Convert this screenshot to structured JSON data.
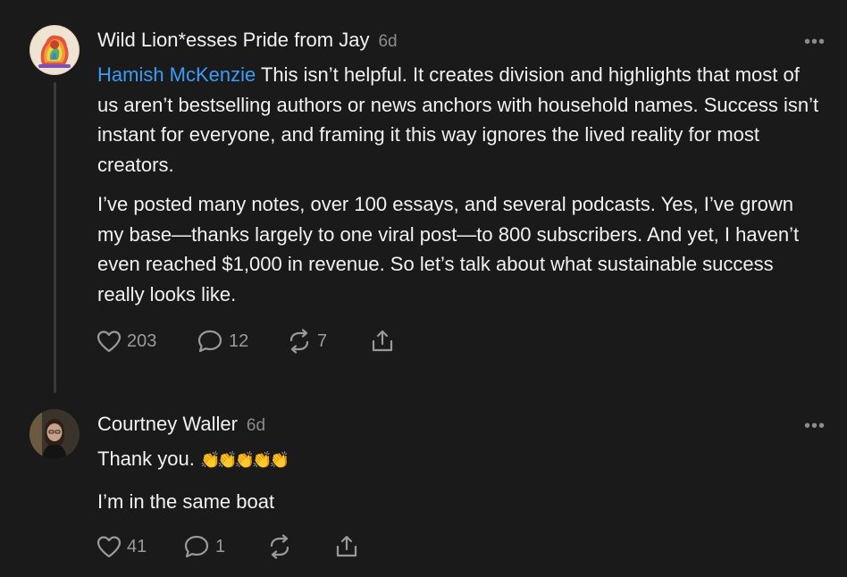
{
  "comments": [
    {
      "author": "Wild Lion*esses Pride from Jay",
      "time": "6d",
      "more_label": "•••",
      "mention": "Hamish McKenzie",
      "paragraph1_rest": " This isn’t helpful. It creates division and highlights that most of us aren’t bestselling authors or news anchors with household names. Success isn’t instant for everyone, and framing it this way ignores the lived reality for most creators.",
      "paragraph2": "I’ve posted many notes, over 100 essays, and several podcasts. Yes, I’ve grown my base—thanks largely to one viral post—to 800 subscribers. And yet, I haven’t even reached $1,000 in revenue. So let’s talk about what sustainable success really looks like.",
      "likes": "203",
      "replies": "12",
      "restacks": "7"
    },
    {
      "author": "Courtney Waller",
      "time": "6d",
      "more_label": "•••",
      "line1": "Thank you. ",
      "emoji": "👏👏👏👏👏",
      "line2": "I’m in the same boat",
      "likes": "41",
      "replies": "1",
      "restacks": ""
    }
  ],
  "colors": {
    "background": "#1a1a1a",
    "mention": "#3a9df5",
    "muted": "#8c8c8c"
  },
  "icons": [
    "heart-icon",
    "comment-icon",
    "restack-icon",
    "share-icon",
    "more-icon"
  ]
}
